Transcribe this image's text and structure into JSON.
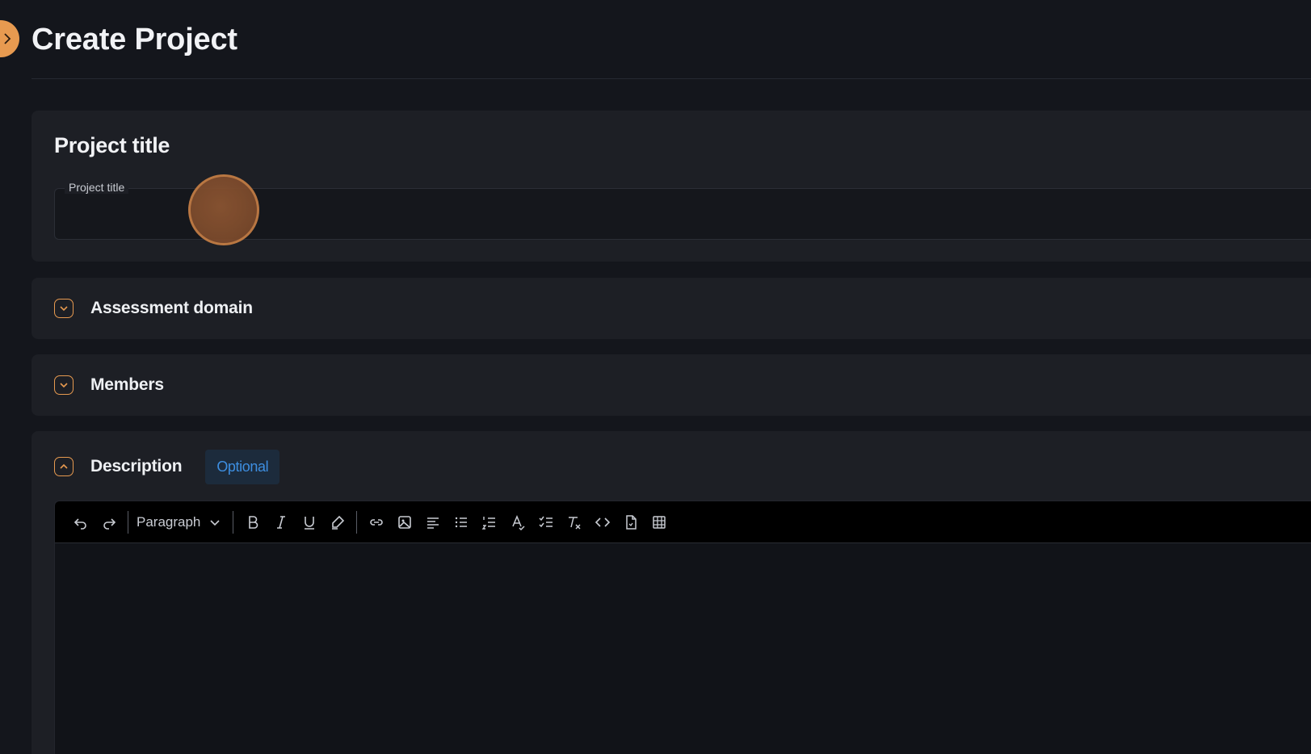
{
  "page": {
    "title": "Create Project"
  },
  "project_title": {
    "heading": "Project title",
    "field_label": "Project title",
    "value": ""
  },
  "sections": {
    "assessment_domain": {
      "label": "Assessment domain",
      "expanded": false
    },
    "members": {
      "label": "Members",
      "expanded": false
    },
    "description": {
      "label": "Description",
      "badge": "Optional",
      "expanded": true
    }
  },
  "editor": {
    "format_value": "Paragraph",
    "toolbar_icons": [
      "undo-icon",
      "redo-icon",
      "bold-icon",
      "italic-icon",
      "underline-icon",
      "highlight-icon",
      "link-icon",
      "image-icon",
      "align-icon",
      "bullet-list-icon",
      "numbered-list-icon",
      "text-color-icon",
      "checklist-icon",
      "clear-format-icon",
      "code-icon",
      "file-icon",
      "table-icon"
    ],
    "content": ""
  },
  "colors": {
    "accent": "#e79a50",
    "badge_text": "#3d8ee0",
    "background": "#14161c",
    "card": "#1d1f25"
  }
}
